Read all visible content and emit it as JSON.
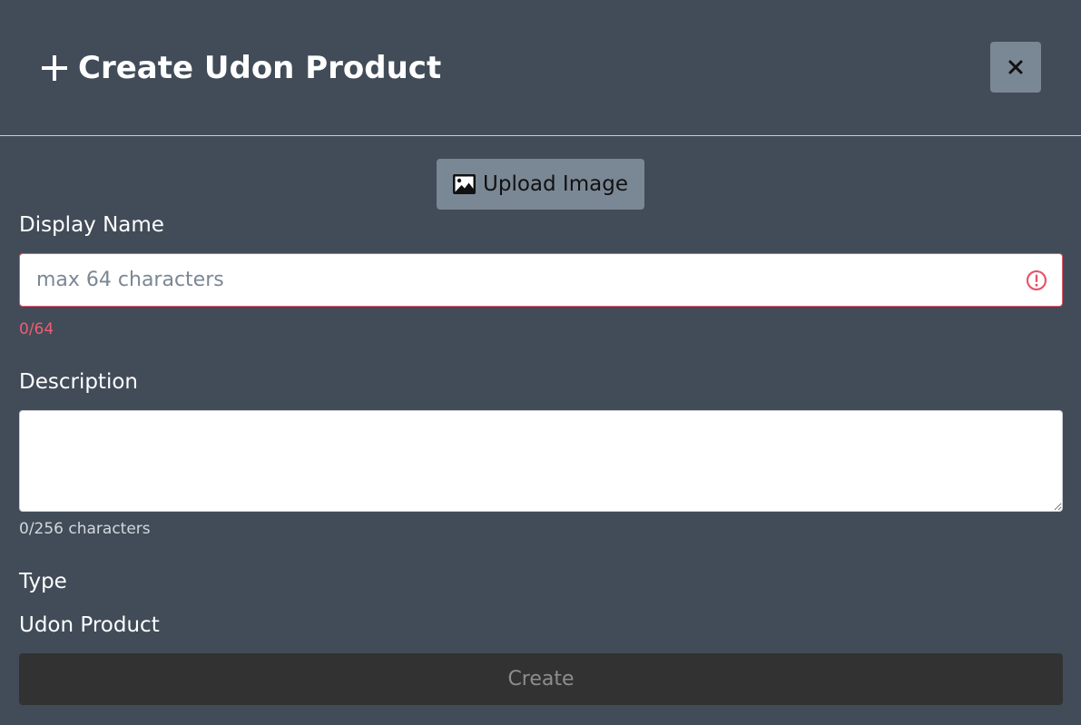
{
  "dialog": {
    "title": "Create Udon Product",
    "title_icon": "plus-icon",
    "close_icon": "close-icon"
  },
  "upload": {
    "label": "Upload Image",
    "icon": "image-icon"
  },
  "display_name": {
    "label": "Display Name",
    "value": "",
    "placeholder": "max 64 characters",
    "counter": "0/64",
    "status_icon": "alert-circle-icon",
    "error_color": "#e5566b"
  },
  "description": {
    "label": "Description",
    "value": "",
    "counter": "0/256 characters"
  },
  "type": {
    "label": "Type",
    "value": "Udon Product"
  },
  "create_button": {
    "label": "Create",
    "disabled": true
  },
  "colors": {
    "background": "#414c58",
    "button": "#7a8795",
    "disabled_button": "#323232"
  }
}
